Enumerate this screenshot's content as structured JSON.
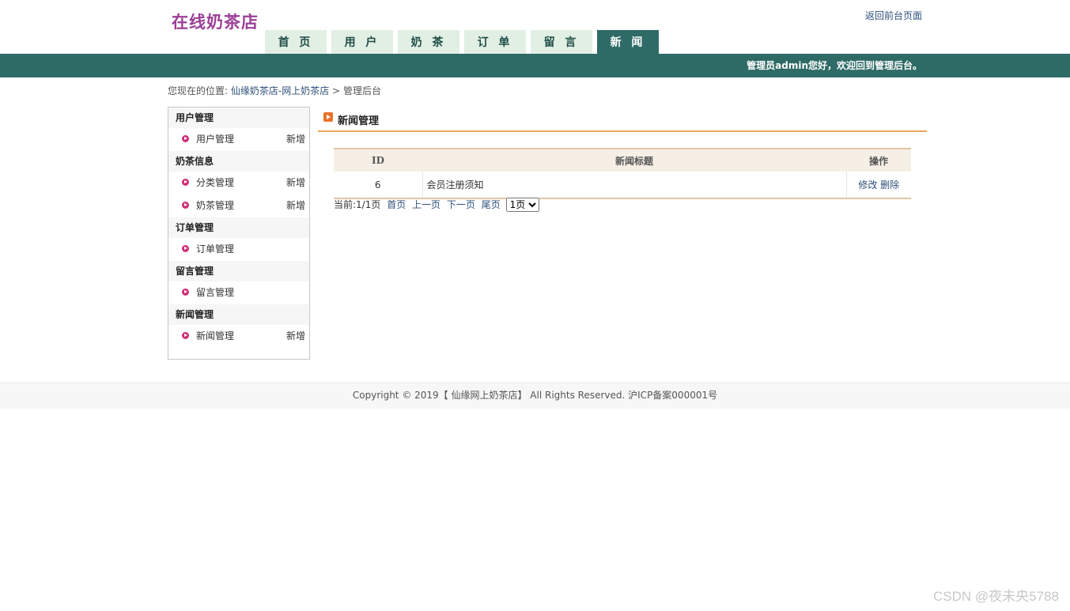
{
  "header": {
    "logo": "在线奶茶店",
    "front_link": "返回前台页面",
    "nav": [
      "首 页",
      "用 户",
      "奶 茶",
      "订 单",
      "留 言",
      "新 闻"
    ],
    "active_index": 5,
    "welcome": "管理员admin您好，欢迎回到管理后台。"
  },
  "breadcrumb": {
    "prefix": "您现在的位置:",
    "site": "仙缘奶茶店-网上奶茶店",
    "sep": ">",
    "current": "管理后台"
  },
  "sidebar": {
    "add_label": "新增",
    "groups": [
      {
        "title": "用户管理",
        "items": [
          {
            "label": "用户管理",
            "add": true
          }
        ]
      },
      {
        "title": "奶茶信息",
        "items": [
          {
            "label": "分类管理",
            "add": true
          },
          {
            "label": "奶茶管理",
            "add": true
          }
        ]
      },
      {
        "title": "订单管理",
        "items": [
          {
            "label": "订单管理",
            "add": false
          }
        ]
      },
      {
        "title": "留言管理",
        "items": [
          {
            "label": "留言管理",
            "add": false
          }
        ]
      },
      {
        "title": "新闻管理",
        "items": [
          {
            "label": "新闻管理",
            "add": true
          }
        ]
      }
    ]
  },
  "main": {
    "title": "新闻管理",
    "table": {
      "headers": [
        "ID",
        "新闻标题",
        "操作"
      ],
      "rows": [
        {
          "id": "6",
          "title": "会员注册须知",
          "edit": "修改",
          "delete": "删除"
        }
      ]
    },
    "pager": {
      "status": "当前:1/1页",
      "first": "首页",
      "prev": "上一页",
      "next": "下一页",
      "last": "尾页",
      "select_value": "1页"
    }
  },
  "footer": {
    "text": "Copyright © 2019【 仙缘网上奶茶店】 All Rights Reserved. 沪ICP备案000001号"
  },
  "watermark": "CSDN @夜未央5788",
  "colors": {
    "accent": "#2f6b66",
    "logo": "#9b3f97",
    "tab_bg": "#e2efe4",
    "rule": "#e8a65a"
  }
}
